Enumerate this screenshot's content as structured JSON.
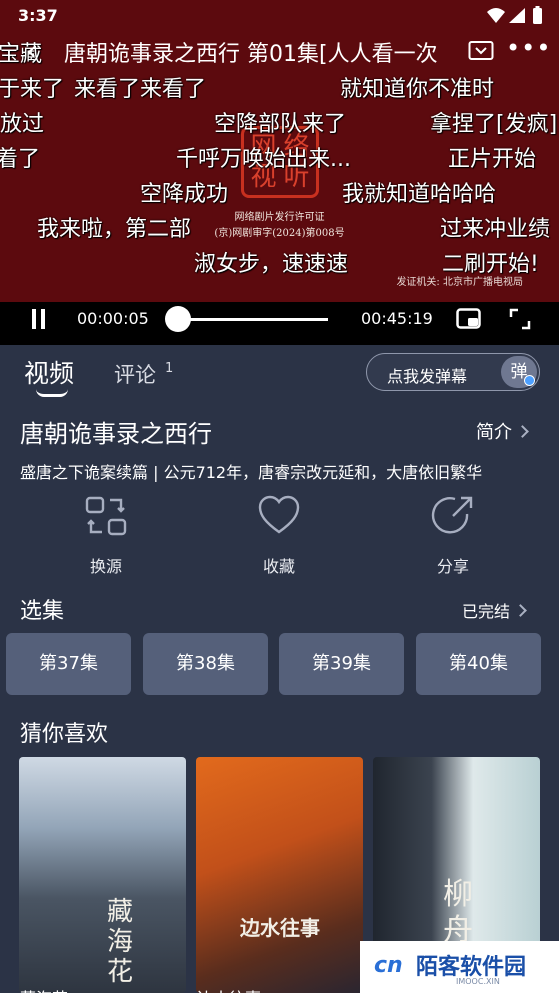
{
  "status_bar": {
    "time": "3:37"
  },
  "player": {
    "title": "唐朝诡事录之西行 第01集[人人看一次",
    "current_time": "00:00:05",
    "duration": "00:45:19",
    "progress": 0.002,
    "license_line1": "网络剧片发行许可证",
    "license_line2": "(京)网剧审字(2024)第008号",
    "issuer": "发证机关: 北京市广播电视局",
    "seal_chars": [
      "网",
      "络",
      "视",
      "听"
    ],
    "danmaku": [
      "宝藏",
      "于来了",
      "来看了来看了",
      "就知道你不准时",
      "放过",
      "空降部队来了",
      "拿捏了[发疯]",
      "着了",
      "千呼万唤始出来...",
      "正片开始",
      "空降成功",
      "我就知道哈哈哈",
      "我来啦，第二部",
      "过来冲业绩",
      "淑女步，速速速",
      "二刷开始!"
    ]
  },
  "tabs": {
    "video": "视频",
    "comment": "评论",
    "comment_count": "1"
  },
  "danmu": {
    "placeholder": "点我发弹幕",
    "toggle": "弹"
  },
  "show": {
    "title": "唐朝诡事录之西行",
    "intro_label": "简介",
    "description": "盛唐之下诡案续篇 | 公元712年，唐睿宗改元延和，大唐依旧繁华"
  },
  "actions": [
    {
      "label": "换源",
      "icon": "switch-source-icon"
    },
    {
      "label": "收藏",
      "icon": "heart-icon"
    },
    {
      "label": "分享",
      "icon": "share-icon"
    }
  ],
  "episodes": {
    "title": "选集",
    "status": "已完结",
    "items": [
      "第37集",
      "第38集",
      "第39集",
      "第40集"
    ]
  },
  "recommend": {
    "title": "猜你喜欢",
    "items": [
      {
        "caption": "藏海花",
        "poster_text": "藏海花"
      },
      {
        "caption": "边水往事",
        "poster_text": "边水往事"
      },
      {
        "caption": "柳舟",
        "poster_text": "柳舟"
      }
    ]
  },
  "watermark": {
    "logo": "cn",
    "text": "陌客软件园",
    "sub": "IMOOC.XIN"
  }
}
